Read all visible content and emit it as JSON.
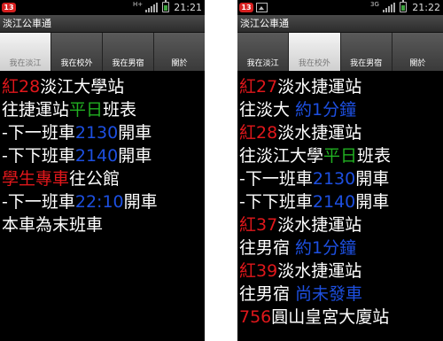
{
  "app_title": "淡江公車通",
  "colors": {
    "red": "#e0171b",
    "green": "#21b021",
    "blue": "#1d4fe0",
    "white": "#ffffff"
  },
  "screens": [
    {
      "status": {
        "notification_badge": "13",
        "network": "H+",
        "time": "21:21"
      },
      "tabs": [
        {
          "label": "我在淡江",
          "active": true
        },
        {
          "label": "我在校外",
          "active": false
        },
        {
          "label": "我在男宿",
          "active": false
        },
        {
          "label": "關於",
          "active": false
        }
      ],
      "lines": [
        {
          "parts": [
            {
              "text": "紅28",
              "color": "red"
            },
            {
              "text": "淡江大學站",
              "color": "white"
            }
          ]
        },
        {
          "parts": [
            {
              "text": "往捷運站",
              "color": "white"
            },
            {
              "text": "平日",
              "color": "green"
            },
            {
              "text": "班表",
              "color": "white"
            }
          ]
        },
        {
          "parts": [
            {
              "text": "-下一班車",
              "color": "white"
            },
            {
              "text": "2130",
              "color": "blue"
            },
            {
              "text": "開車",
              "color": "white"
            }
          ]
        },
        {
          "parts": [
            {
              "text": "-下下班車",
              "color": "white"
            },
            {
              "text": "2140",
              "color": "blue"
            },
            {
              "text": "開車",
              "color": "white"
            }
          ]
        },
        {
          "parts": [
            {
              "text": "學生專車",
              "color": "red"
            },
            {
              "text": "往公館",
              "color": "white"
            }
          ]
        },
        {
          "parts": [
            {
              "text": "-下一班車",
              "color": "white"
            },
            {
              "text": "22:10",
              "color": "blue"
            },
            {
              "text": "開車",
              "color": "white"
            }
          ]
        },
        {
          "parts": [
            {
              "text": "本車為末班車",
              "color": "white"
            }
          ]
        }
      ]
    },
    {
      "status": {
        "notification_badge": "13",
        "network": "3G",
        "time": "21:22"
      },
      "tabs": [
        {
          "label": "我在淡江",
          "active": false
        },
        {
          "label": "我在校外",
          "active": true
        },
        {
          "label": "我在男宿",
          "active": false
        },
        {
          "label": "關於",
          "active": false
        }
      ],
      "lines": [
        {
          "parts": [
            {
              "text": "紅27",
              "color": "red"
            },
            {
              "text": "淡水捷運站",
              "color": "white"
            }
          ]
        },
        {
          "parts": [
            {
              "text": "往淡大 ",
              "color": "white"
            },
            {
              "text": "約1分鐘",
              "color": "blue"
            }
          ]
        },
        {
          "parts": [
            {
              "text": "紅28",
              "color": "red"
            },
            {
              "text": "淡水捷運站",
              "color": "white"
            }
          ]
        },
        {
          "parts": [
            {
              "text": "往淡江大學",
              "color": "white"
            },
            {
              "text": "平日",
              "color": "green"
            },
            {
              "text": "班表",
              "color": "white"
            }
          ]
        },
        {
          "parts": [
            {
              "text": "-下一班車",
              "color": "white"
            },
            {
              "text": "2130",
              "color": "blue"
            },
            {
              "text": "開車",
              "color": "white"
            }
          ]
        },
        {
          "parts": [
            {
              "text": "-下下班車",
              "color": "white"
            },
            {
              "text": "2140",
              "color": "blue"
            },
            {
              "text": "開車",
              "color": "white"
            }
          ]
        },
        {
          "parts": [
            {
              "text": "紅37",
              "color": "red"
            },
            {
              "text": "淡水捷運站",
              "color": "white"
            }
          ]
        },
        {
          "parts": [
            {
              "text": "往男宿 ",
              "color": "white"
            },
            {
              "text": "約1分鐘",
              "color": "blue"
            }
          ]
        },
        {
          "parts": [
            {
              "text": "紅39",
              "color": "red"
            },
            {
              "text": "淡水捷運站",
              "color": "white"
            }
          ]
        },
        {
          "parts": [
            {
              "text": "往男宿 ",
              "color": "white"
            },
            {
              "text": "尚未發車",
              "color": "blue"
            }
          ]
        },
        {
          "parts": [
            {
              "text": "756",
              "color": "red"
            },
            {
              "text": "圓山皇宮大廈站",
              "color": "white"
            }
          ]
        }
      ]
    }
  ]
}
